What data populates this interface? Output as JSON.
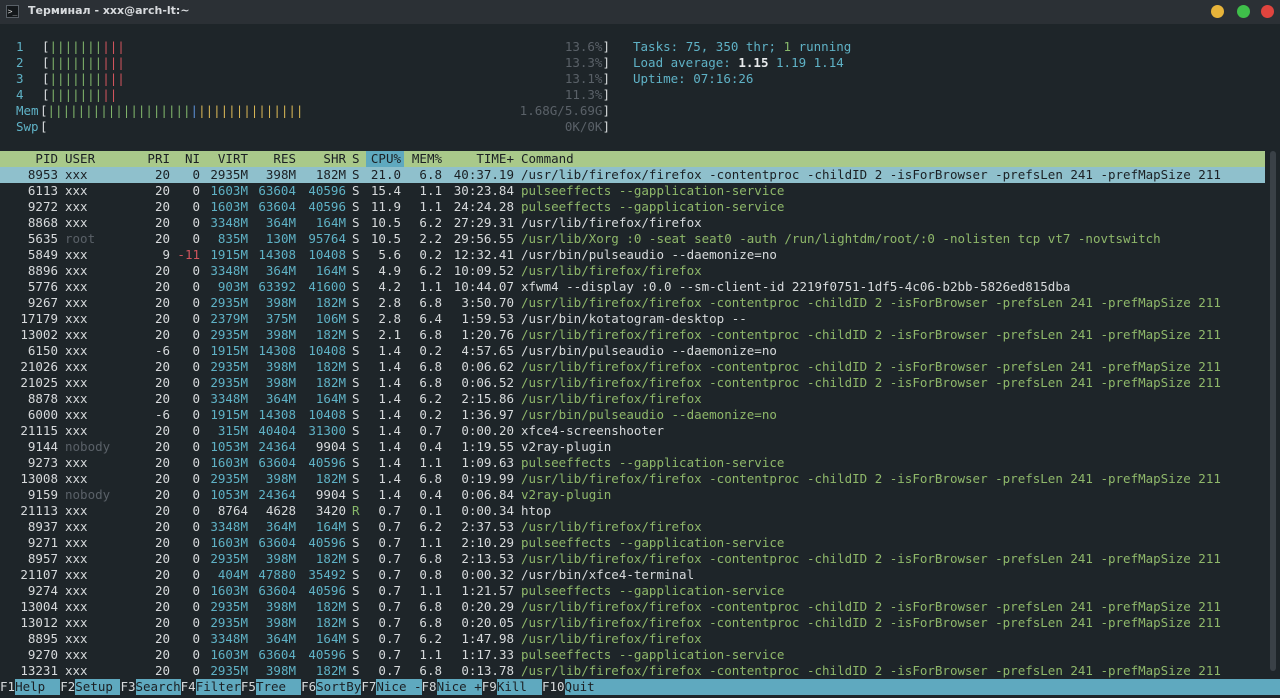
{
  "window": {
    "title": "Терминал - xxx@arch-lt:~",
    "icon": "terminal-icon",
    "buttons": {
      "minimize": "#e7b43a",
      "maximize": "#3fbf4a",
      "close": "#e0443e"
    }
  },
  "meters": {
    "cpus": [
      {
        "label": "1",
        "bars_green": "|||||||",
        "bars_red": "|||",
        "percent": "13.6%"
      },
      {
        "label": "2",
        "bars_green": "|||||||",
        "bars_red": "|||",
        "percent": "13.3%"
      },
      {
        "label": "3",
        "bars_green": "|||||||",
        "bars_red": "|||",
        "percent": "13.1%"
      },
      {
        "label": "4",
        "bars_green": "|||||||",
        "bars_red": "||",
        "percent": "11.3%"
      }
    ],
    "mem": {
      "label": "Mem",
      "bars_green": "|||||||||||||||||||",
      "bars_blue": "|",
      "bars_yellow": "||||||||||||||",
      "value": "1.68G/5.69G"
    },
    "swp": {
      "label": "Swp",
      "value": "0K/0K"
    }
  },
  "info": {
    "tasks_label": "Tasks:",
    "tasks": "75,",
    "thr": "350",
    "thr_label": "thr;",
    "running": "1",
    "running_label": "running",
    "load_label": "Load average:",
    "load1": "1.15",
    "load5": "1.19",
    "load15": "1.14",
    "uptime_label": "Uptime:",
    "uptime": "07:16:26"
  },
  "columns": [
    "PID",
    "USER",
    "PRI",
    "NI",
    "VIRT",
    "RES",
    "SHR",
    "S",
    "CPU%",
    "MEM%",
    "TIME+",
    "Command"
  ],
  "processes": [
    [
      "8953",
      "xxx",
      "20",
      "0",
      "2935M",
      "398M",
      "182M",
      "S",
      "21.0",
      "6.8",
      "40:37.19",
      "/usr/lib/firefox/firefox -contentproc -childID 2 -isForBrowser -prefsLen 241 -prefMapSize 211"
    ],
    [
      "6113",
      "xxx",
      "20",
      "0",
      "1603M",
      "63604",
      "40596",
      "S",
      "15.4",
      "1.1",
      "30:23.84",
      "pulseeffects --gapplication-service"
    ],
    [
      "9272",
      "xxx",
      "20",
      "0",
      "1603M",
      "63604",
      "40596",
      "S",
      "11.9",
      "1.1",
      "24:24.28",
      "pulseeffects --gapplication-service"
    ],
    [
      "8868",
      "xxx",
      "20",
      "0",
      "3348M",
      "364M",
      "164M",
      "S",
      "10.5",
      "6.2",
      "27:29.31",
      "/usr/lib/firefox/firefox"
    ],
    [
      "5635",
      "root",
      "20",
      "0",
      "835M",
      "130M",
      "95764",
      "S",
      "10.5",
      "2.2",
      "29:56.55",
      "/usr/lib/Xorg :0 -seat seat0 -auth /run/lightdm/root/:0 -nolisten tcp vt7 -novtswitch"
    ],
    [
      "5849",
      "xxx",
      "9",
      "-11",
      "1915M",
      "14308",
      "10408",
      "S",
      "5.6",
      "0.2",
      "12:32.41",
      "/usr/bin/pulseaudio --daemonize=no"
    ],
    [
      "8896",
      "xxx",
      "20",
      "0",
      "3348M",
      "364M",
      "164M",
      "S",
      "4.9",
      "6.2",
      "10:09.52",
      "/usr/lib/firefox/firefox"
    ],
    [
      "5776",
      "xxx",
      "20",
      "0",
      "903M",
      "63392",
      "41600",
      "S",
      "4.2",
      "1.1",
      "10:44.07",
      "xfwm4 --display :0.0 --sm-client-id 2219f0751-1df5-4c06-b2bb-5826ed815dba"
    ],
    [
      "9267",
      "xxx",
      "20",
      "0",
      "2935M",
      "398M",
      "182M",
      "S",
      "2.8",
      "6.8",
      "3:50.70",
      "/usr/lib/firefox/firefox -contentproc -childID 2 -isForBrowser -prefsLen 241 -prefMapSize 211"
    ],
    [
      "17179",
      "xxx",
      "20",
      "0",
      "2379M",
      "375M",
      "106M",
      "S",
      "2.8",
      "6.4",
      "1:59.53",
      "/usr/bin/kotatogram-desktop --"
    ],
    [
      "13002",
      "xxx",
      "20",
      "0",
      "2935M",
      "398M",
      "182M",
      "S",
      "2.1",
      "6.8",
      "1:20.76",
      "/usr/lib/firefox/firefox -contentproc -childID 2 -isForBrowser -prefsLen 241 -prefMapSize 211"
    ],
    [
      "6150",
      "xxx",
      "-6",
      "0",
      "1915M",
      "14308",
      "10408",
      "S",
      "1.4",
      "0.2",
      "4:57.65",
      "/usr/bin/pulseaudio --daemonize=no"
    ],
    [
      "21026",
      "xxx",
      "20",
      "0",
      "2935M",
      "398M",
      "182M",
      "S",
      "1.4",
      "6.8",
      "0:06.62",
      "/usr/lib/firefox/firefox -contentproc -childID 2 -isForBrowser -prefsLen 241 -prefMapSize 211"
    ],
    [
      "21025",
      "xxx",
      "20",
      "0",
      "2935M",
      "398M",
      "182M",
      "S",
      "1.4",
      "6.8",
      "0:06.52",
      "/usr/lib/firefox/firefox -contentproc -childID 2 -isForBrowser -prefsLen 241 -prefMapSize 211"
    ],
    [
      "8878",
      "xxx",
      "20",
      "0",
      "3348M",
      "364M",
      "164M",
      "S",
      "1.4",
      "6.2",
      "2:15.86",
      "/usr/lib/firefox/firefox"
    ],
    [
      "6000",
      "xxx",
      "-6",
      "0",
      "1915M",
      "14308",
      "10408",
      "S",
      "1.4",
      "0.2",
      "1:36.97",
      "/usr/bin/pulseaudio --daemonize=no"
    ],
    [
      "21115",
      "xxx",
      "20",
      "0",
      "315M",
      "40404",
      "31300",
      "S",
      "1.4",
      "0.7",
      "0:00.20",
      "xfce4-screenshooter"
    ],
    [
      "9144",
      "nobody",
      "20",
      "0",
      "1053M",
      "24364",
      "9904",
      "S",
      "1.4",
      "0.4",
      "1:19.55",
      "v2ray-plugin"
    ],
    [
      "9273",
      "xxx",
      "20",
      "0",
      "1603M",
      "63604",
      "40596",
      "S",
      "1.4",
      "1.1",
      "1:09.63",
      "pulseeffects --gapplication-service"
    ],
    [
      "13008",
      "xxx",
      "20",
      "0",
      "2935M",
      "398M",
      "182M",
      "S",
      "1.4",
      "6.8",
      "0:19.99",
      "/usr/lib/firefox/firefox -contentproc -childID 2 -isForBrowser -prefsLen 241 -prefMapSize 211"
    ],
    [
      "9159",
      "nobody",
      "20",
      "0",
      "1053M",
      "24364",
      "9904",
      "S",
      "1.4",
      "0.4",
      "0:06.84",
      "v2ray-plugin"
    ],
    [
      "21113",
      "xxx",
      "20",
      "0",
      "8764",
      "4628",
      "3420",
      "R",
      "0.7",
      "0.1",
      "0:00.34",
      "htop"
    ],
    [
      "8937",
      "xxx",
      "20",
      "0",
      "3348M",
      "364M",
      "164M",
      "S",
      "0.7",
      "6.2",
      "2:37.53",
      "/usr/lib/firefox/firefox"
    ],
    [
      "9271",
      "xxx",
      "20",
      "0",
      "1603M",
      "63604",
      "40596",
      "S",
      "0.7",
      "1.1",
      "2:10.29",
      "pulseeffects --gapplication-service"
    ],
    [
      "8957",
      "xxx",
      "20",
      "0",
      "2935M",
      "398M",
      "182M",
      "S",
      "0.7",
      "6.8",
      "2:13.53",
      "/usr/lib/firefox/firefox -contentproc -childID 2 -isForBrowser -prefsLen 241 -prefMapSize 211"
    ],
    [
      "21107",
      "xxx",
      "20",
      "0",
      "404M",
      "47880",
      "35492",
      "S",
      "0.7",
      "0.8",
      "0:00.32",
      "/usr/bin/xfce4-terminal"
    ],
    [
      "9274",
      "xxx",
      "20",
      "0",
      "1603M",
      "63604",
      "40596",
      "S",
      "0.7",
      "1.1",
      "1:21.57",
      "pulseeffects --gapplication-service"
    ],
    [
      "13004",
      "xxx",
      "20",
      "0",
      "2935M",
      "398M",
      "182M",
      "S",
      "0.7",
      "6.8",
      "0:20.29",
      "/usr/lib/firefox/firefox -contentproc -childID 2 -isForBrowser -prefsLen 241 -prefMapSize 211"
    ],
    [
      "13012",
      "xxx",
      "20",
      "0",
      "2935M",
      "398M",
      "182M",
      "S",
      "0.7",
      "6.8",
      "0:20.05",
      "/usr/lib/firefox/firefox -contentproc -childID 2 -isForBrowser -prefsLen 241 -prefMapSize 211"
    ],
    [
      "8895",
      "xxx",
      "20",
      "0",
      "3348M",
      "364M",
      "164M",
      "S",
      "0.7",
      "6.2",
      "1:47.98",
      "/usr/lib/firefox/firefox"
    ],
    [
      "9270",
      "xxx",
      "20",
      "0",
      "1603M",
      "63604",
      "40596",
      "S",
      "0.7",
      "1.1",
      "1:17.33",
      "pulseeffects --gapplication-service"
    ],
    [
      "13231",
      "xxx",
      "20",
      "0",
      "2935M",
      "398M",
      "182M",
      "S",
      "0.7",
      "6.8",
      "0:13.78",
      "/usr/lib/firefox/firefox -contentproc -childID 2 -isForBrowser -prefsLen 241 -prefMapSize 211"
    ]
  ],
  "thread_rows": [
    1,
    2,
    4,
    6,
    8,
    10,
    12,
    13,
    14,
    15,
    18,
    19,
    20,
    22,
    23,
    24,
    26,
    27,
    28,
    29,
    30,
    31
  ],
  "selected_row": 0,
  "function_keys": [
    {
      "key": "F1",
      "label": "Help  "
    },
    {
      "key": "F2",
      "label": "Setup "
    },
    {
      "key": "F3",
      "label": "Search"
    },
    {
      "key": "F4",
      "label": "Filter"
    },
    {
      "key": "F5",
      "label": "Tree  "
    },
    {
      "key": "F6",
      "label": "SortBy"
    },
    {
      "key": "F7",
      "label": "Nice -"
    },
    {
      "key": "F8",
      "label": "Nice +"
    },
    {
      "key": "F9",
      "label": "Kill  "
    },
    {
      "key": "F10",
      "label": "Quit"
    }
  ]
}
